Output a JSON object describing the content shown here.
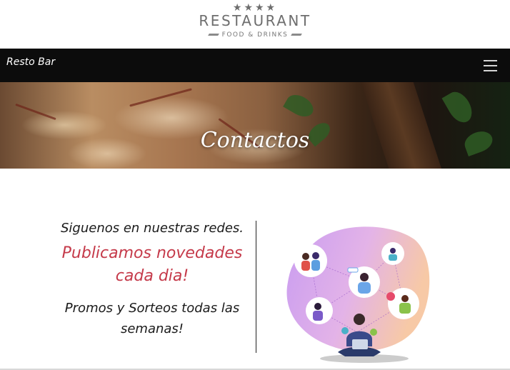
{
  "logo": {
    "stars": "★★★★",
    "name": "RESTAURANT",
    "tagline": "FOOD & DRINKS"
  },
  "navbar": {
    "brand": "Resto Bar",
    "menu_icon": "hamburger-menu-icon"
  },
  "hero": {
    "title": "Contactos"
  },
  "social": {
    "line1": "Siguenos en nuestras redes.",
    "line2": "Publicamos novedades cada dia!",
    "line3": "Promos y Sorteos todas las semanas!"
  },
  "colors": {
    "navbar_bg": "#0c0c0c",
    "accent_red": "#c53a4a",
    "blob_purple": "#c99cf0",
    "blob_orange": "#f7c9a6"
  }
}
